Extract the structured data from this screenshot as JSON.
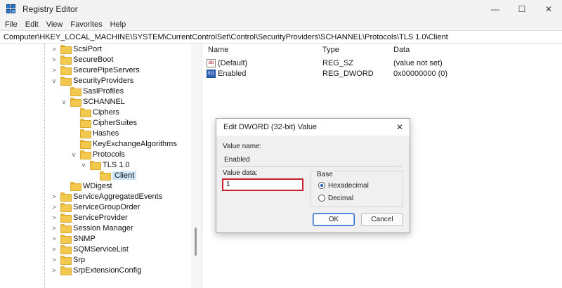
{
  "window": {
    "title": "Registry Editor",
    "minimize_glyph": "—",
    "maximize_glyph": "☐",
    "close_glyph": "✕",
    "icon": "registry-editor-icon"
  },
  "menu": [
    "File",
    "Edit",
    "View",
    "Favorites",
    "Help"
  ],
  "address": "Computer\\HKEY_LOCAL_MACHINE\\SYSTEM\\CurrentControlSet\\Control\\SecurityProviders\\SCHANNEL\\Protocols\\TLS 1.0\\Client",
  "tree": [
    {
      "label": "ScsiPort",
      "chevron": ">"
    },
    {
      "label": "SecureBoot",
      "chevron": ">"
    },
    {
      "label": "SecurePipeServers",
      "chevron": ">"
    },
    {
      "label": "SecurityProviders",
      "chevron": "v"
    },
    {
      "label": "SaslProfiles",
      "chevron": ""
    },
    {
      "label": "SCHANNEL",
      "chevron": "v"
    },
    {
      "label": "Ciphers",
      "chevron": ""
    },
    {
      "label": "CipherSuites",
      "chevron": ""
    },
    {
      "label": "Hashes",
      "chevron": ""
    },
    {
      "label": "KeyExchangeAlgorithms",
      "chevron": ""
    },
    {
      "label": "Protocols",
      "chevron": "v"
    },
    {
      "label": "TLS 1.0",
      "chevron": "v"
    },
    {
      "label": "Client",
      "chevron": "",
      "selected": true
    },
    {
      "label": "WDigest",
      "chevron": ""
    },
    {
      "label": "ServiceAggregatedEvents",
      "chevron": ">"
    },
    {
      "label": "ServiceGroupOrder",
      "chevron": ">"
    },
    {
      "label": "ServiceProvider",
      "chevron": ">"
    },
    {
      "label": "Session Manager",
      "chevron": ">"
    },
    {
      "label": "SNMP",
      "chevron": ">"
    },
    {
      "label": "SQMServiceList",
      "chevron": ">"
    },
    {
      "label": "Srp",
      "chevron": ">"
    },
    {
      "label": "SrpExtensionConfig",
      "chevron": ">"
    }
  ],
  "list": {
    "headers": {
      "name": "Name",
      "type": "Type",
      "data": "Data"
    },
    "rows": [
      {
        "icon": "string-value-icon",
        "icon_text": "ab",
        "name": "(Default)",
        "type": "REG_SZ",
        "data": "(value not set)"
      },
      {
        "icon": "binary-value-icon",
        "icon_text": "011",
        "name": "Enabled",
        "type": "REG_DWORD",
        "data": "0x00000000 (0)"
      }
    ]
  },
  "dialog": {
    "title": "Edit DWORD (32-bit) Value",
    "close_glyph": "✕",
    "value_name_label": "Value name:",
    "value_name": "Enabled",
    "value_data_label": "Value data:",
    "value_data": "1",
    "base_label": "Base",
    "radio_hex": "Hexadecimal",
    "radio_dec": "Decimal",
    "selected_base": "Hexadecimal",
    "ok_label": "OK",
    "cancel_label": "Cancel"
  },
  "colors": {
    "highlight_border": "#c8202c",
    "selection": "#cce4f7"
  }
}
